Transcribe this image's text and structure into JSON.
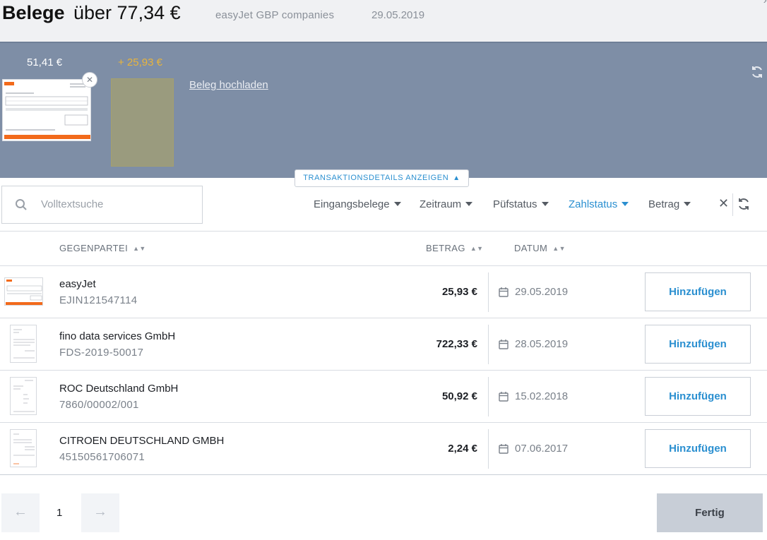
{
  "header": {
    "title_strong": "Belege",
    "title_rest": "über 77,34 €",
    "subtitle": "easyJet GBP companies",
    "date": "29.05.2019"
  },
  "strip": {
    "amount_attached": "51,41 €",
    "amount_pending": "+ 25,93 €",
    "upload_label": "Beleg hochladen",
    "accent_color": "#e8b43c"
  },
  "details_toggle": {
    "label": "TRANSAKTIONSDETAILS ANZEIGEN"
  },
  "search": {
    "placeholder": "Volltextsuche"
  },
  "filters": [
    {
      "label": "Eingangsbelege",
      "active": false
    },
    {
      "label": "Zeitraum",
      "active": false
    },
    {
      "label": "Püfstatus",
      "active": false
    },
    {
      "label": "Zahlstatus",
      "active": true
    },
    {
      "label": "Betrag",
      "active": false
    }
  ],
  "table": {
    "columns": {
      "party": "GEGENPARTEI",
      "amount": "BETRAG",
      "date": "DATUM"
    },
    "rows": [
      {
        "party": "easyJet",
        "ref": "EJIN121547114",
        "amount": "25,93 €",
        "date": "29.05.2019",
        "action": "Hinzufügen"
      },
      {
        "party": "fino data services GmbH",
        "ref": "FDS-2019-50017",
        "amount": "722,33 €",
        "date": "28.05.2019",
        "action": "Hinzufügen"
      },
      {
        "party": "ROC Deutschland GmbH",
        "ref": "7860/00002/001",
        "amount": "50,92 €",
        "date": "15.02.2018",
        "action": "Hinzufügen"
      },
      {
        "party": "CITROEN DEUTSCHLAND GMBH",
        "ref": "45150561706071",
        "amount": "2,24 €",
        "date": "07.06.2017",
        "action": "Hinzufügen"
      }
    ]
  },
  "pagination": {
    "page": "1"
  },
  "footer": {
    "done_label": "Fertig"
  },
  "colors": {
    "accent": "#2a8fd0",
    "strip_bg": "#7e8ea6"
  }
}
